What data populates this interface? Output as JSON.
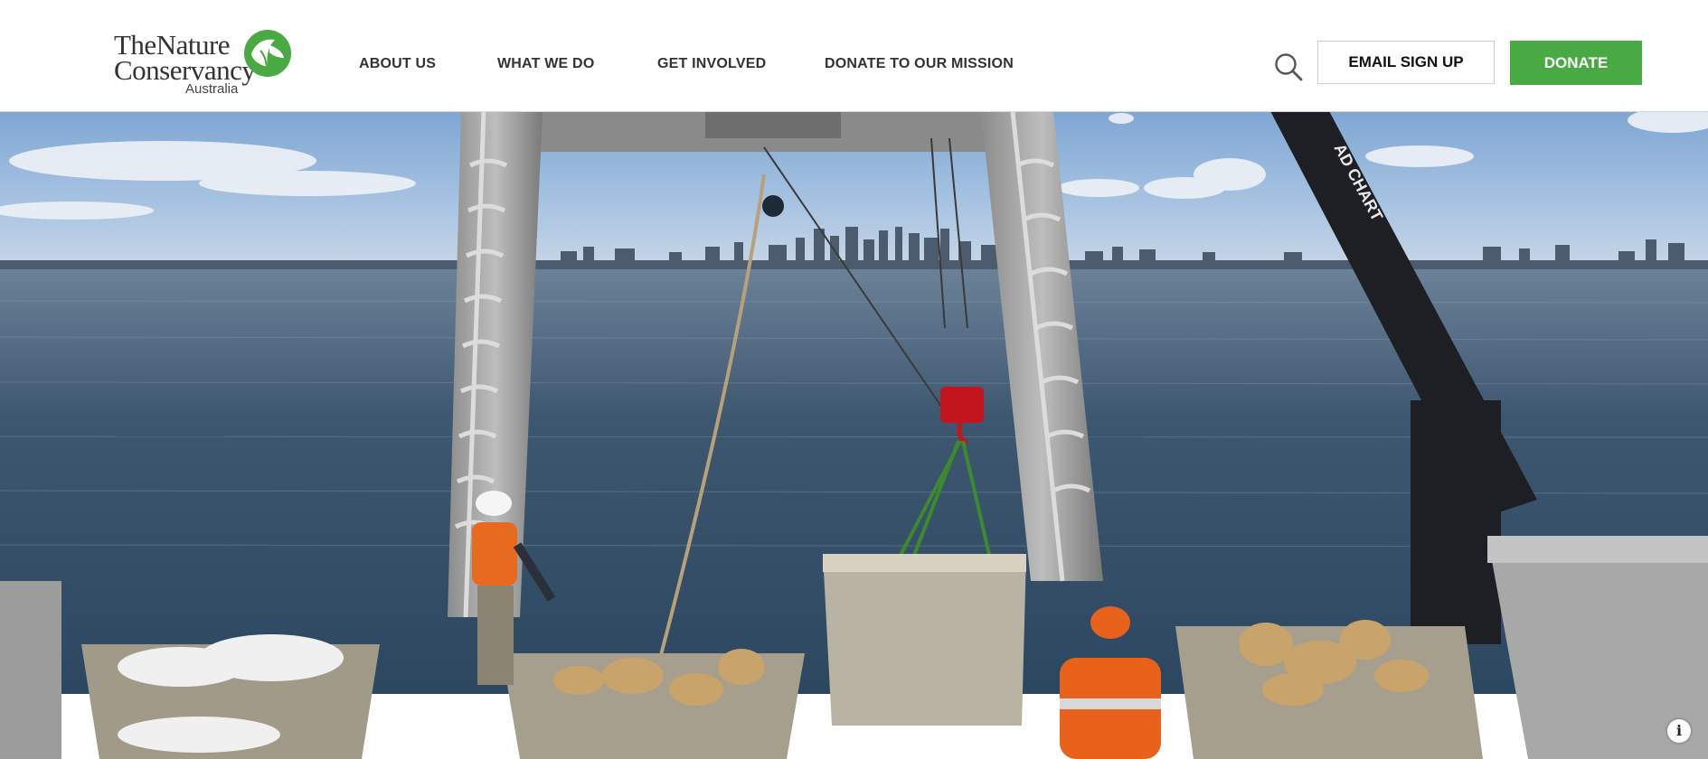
{
  "header": {
    "logo": {
      "line1": "TheNature",
      "line2": "Conservancy",
      "sub": "Australia",
      "accent_color": "#49a942"
    },
    "nav": [
      {
        "label": "ABOUT US"
      },
      {
        "label": "WHAT WE DO"
      },
      {
        "label": "GET INVOLVED"
      },
      {
        "label": "DONATE TO OUR MISSION"
      }
    ],
    "search_icon": "search-icon",
    "email_signup_label": "EMAIL SIGN UP",
    "donate_label": "DONATE",
    "donate_color": "#49a942"
  },
  "hero": {
    "scene": "reef-restoration-boat-deck-with-crane-and-city-skyline",
    "crane_text": "AD CHART",
    "info_icon": "info-icon",
    "info_label": "i"
  }
}
